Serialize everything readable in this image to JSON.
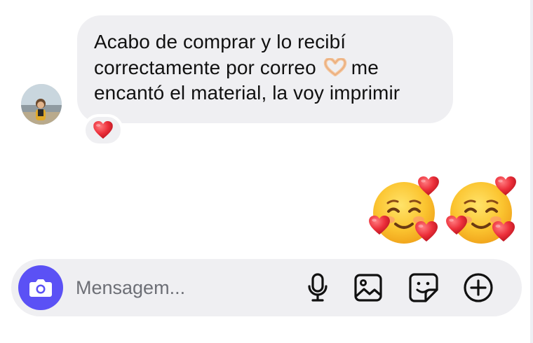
{
  "conversation": {
    "incoming": {
      "lines": [
        "Acabo de comprar y lo recibí",
        "correctamente por correo",
        "me",
        "encantó el material, la voy imprimir"
      ],
      "inline_emoji": "heart-hands",
      "reaction_icon": "red-heart"
    },
    "outgoing": {
      "emoji": "smiling-face-with-hearts",
      "emoji_count": 2
    }
  },
  "composer": {
    "placeholder": "Mensagem...",
    "value": "",
    "icons": [
      "camera-icon",
      "microphone-icon",
      "gallery-icon",
      "sticker-icon",
      "add-icon"
    ],
    "accent_color": "#5b51f5"
  },
  "colors": {
    "bubble": "#efeff2",
    "heart": "#e8303a"
  }
}
